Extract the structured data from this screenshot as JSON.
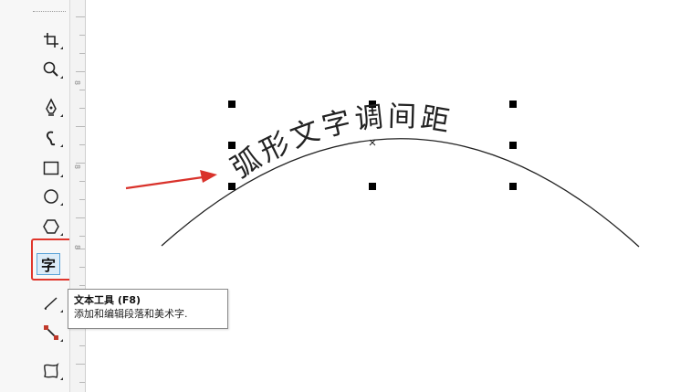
{
  "canvas": {
    "arc_text": "弧形文字调间距",
    "arc_characters": [
      "弧",
      "形",
      "文",
      "字",
      "调",
      "间",
      "距"
    ]
  },
  "toolbar": {
    "tools": [
      {
        "name": "crop-tool",
        "icon": "crop-icon"
      },
      {
        "name": "zoom-tool",
        "icon": "magnifier-icon"
      },
      {
        "name": "freehand-tool",
        "icon": "pen-nib-icon"
      },
      {
        "name": "artistic-media-tool",
        "icon": "brush-curve-icon"
      },
      {
        "name": "rectangle-tool",
        "icon": "rectangle-icon"
      },
      {
        "name": "ellipse-tool",
        "icon": "ellipse-icon"
      },
      {
        "name": "polygon-tool",
        "icon": "hexagon-icon"
      },
      {
        "name": "text-tool",
        "icon": "text-char-icon"
      },
      {
        "name": "parallel-dimension-tool",
        "icon": "dimension-line-icon"
      },
      {
        "name": "connector-tool",
        "icon": "connector-icon"
      },
      {
        "name": "shape-tool",
        "icon": "shape-blob-icon"
      }
    ],
    "text_tool_glyph": "字"
  },
  "ruler": {
    "labels": [
      "8",
      "8",
      "8"
    ]
  },
  "tooltip": {
    "title": "文本工具 (F8)",
    "description": "添加和编辑段落和美术字."
  },
  "colors": {
    "highlight": "#e0362c",
    "arrow": "#d9322b",
    "text_tool_fill": "#dcecf8",
    "text_tool_border": "#5aa3d8"
  }
}
